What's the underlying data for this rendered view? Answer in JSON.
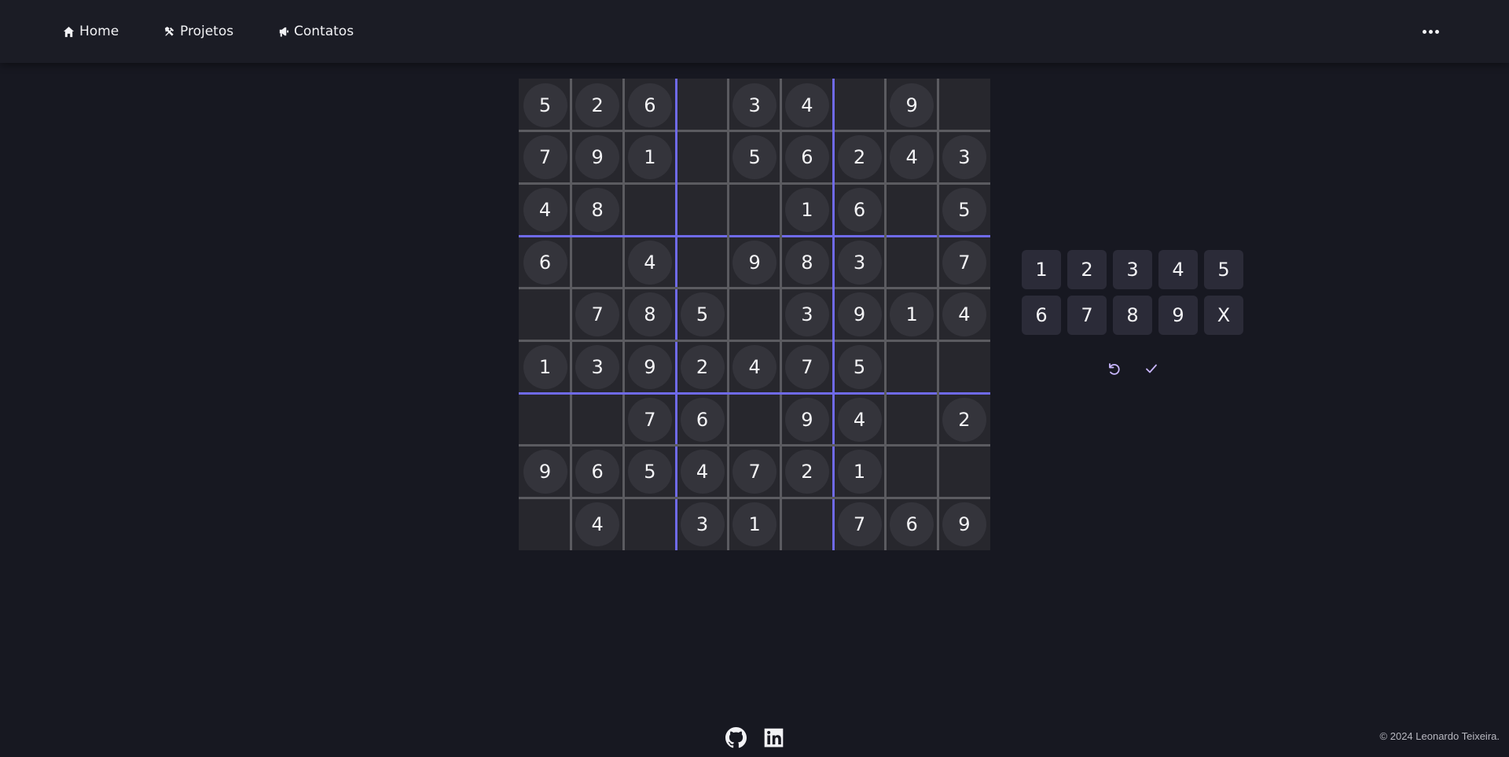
{
  "nav": {
    "home": {
      "label": "Home",
      "icon": "home-icon"
    },
    "projetos": {
      "label": "Projetos",
      "icon": "tools-icon"
    },
    "contatos": {
      "label": "Contatos",
      "icon": "megaphone-icon"
    },
    "more_icon": "more-horizontal-icon"
  },
  "board": {
    "cells": [
      [
        5,
        2,
        6,
        0,
        3,
        4,
        0,
        9,
        0
      ],
      [
        7,
        9,
        1,
        0,
        5,
        6,
        2,
        4,
        3
      ],
      [
        4,
        8,
        0,
        0,
        0,
        1,
        6,
        0,
        5
      ],
      [
        6,
        0,
        4,
        0,
        9,
        8,
        3,
        0,
        7
      ],
      [
        0,
        7,
        8,
        5,
        0,
        3,
        9,
        1,
        4
      ],
      [
        1,
        3,
        9,
        2,
        4,
        7,
        5,
        0,
        0
      ],
      [
        0,
        0,
        7,
        6,
        0,
        9,
        4,
        0,
        2
      ],
      [
        9,
        6,
        5,
        4,
        7,
        2,
        1,
        0,
        0
      ],
      [
        0,
        4,
        0,
        3,
        1,
        0,
        7,
        6,
        9
      ]
    ]
  },
  "keypad": {
    "keys": [
      "1",
      "2",
      "3",
      "4",
      "5",
      "6",
      "7",
      "8",
      "9",
      "X"
    ],
    "undo_icon": "undo-icon",
    "check_icon": "check-icon"
  },
  "footer": {
    "github_icon": "github-icon",
    "linkedin_icon": "linkedin-icon",
    "copyright": "© 2024 Leonardo Teixeira."
  },
  "colors": {
    "background": "#171821",
    "accent": "#6f6ae8",
    "action_icon": "#c9b7ff"
  }
}
